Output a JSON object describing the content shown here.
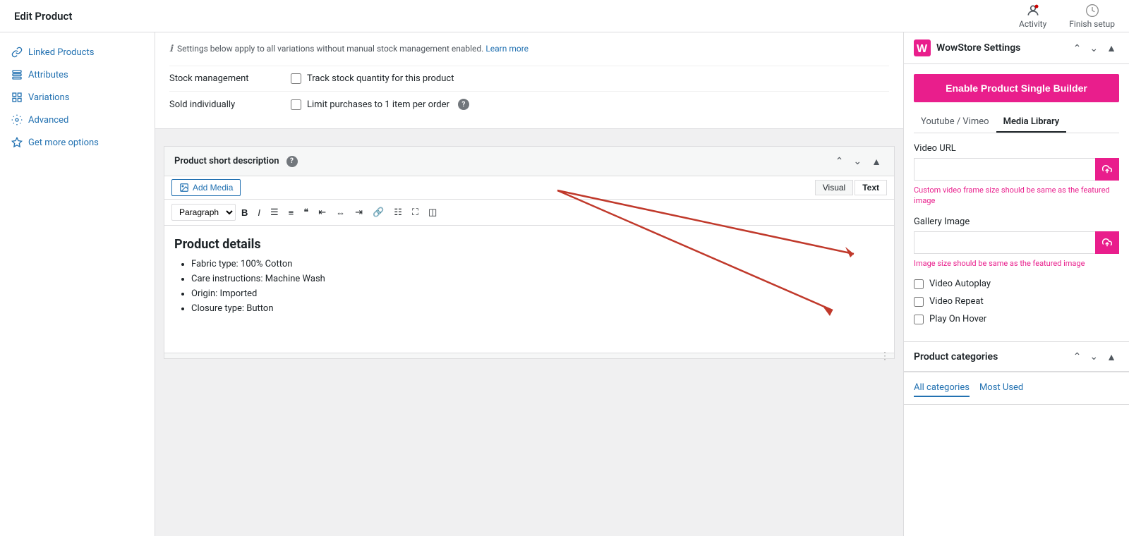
{
  "page": {
    "title": "Edit Product"
  },
  "topbar": {
    "title": "Edit Product",
    "activity_label": "Activity",
    "finish_setup_label": "Finish setup"
  },
  "sidebar": {
    "items": [
      {
        "id": "linked-products",
        "label": "Linked Products",
        "icon": "link"
      },
      {
        "id": "attributes",
        "label": "Attributes",
        "icon": "list"
      },
      {
        "id": "variations",
        "label": "Variations",
        "icon": "grid"
      },
      {
        "id": "advanced",
        "label": "Advanced",
        "icon": "gear"
      },
      {
        "id": "get-more-options",
        "label": "Get more options",
        "icon": "star"
      }
    ]
  },
  "stock_section": {
    "notice": "Settings below apply to all variations without manual stock management enabled.",
    "notice_link": "Learn more",
    "stock_management_label": "Stock management",
    "stock_management_checkbox": "Track stock quantity for this product",
    "sold_individually_label": "Sold individually",
    "sold_individually_checkbox": "Limit purchases to 1 item per order"
  },
  "editor_section": {
    "title": "Product short description",
    "add_media_label": "Add Media",
    "tab_visual": "Visual",
    "tab_text": "Text",
    "format_label": "Paragraph",
    "content_heading": "Product details",
    "content_items": [
      "Fabric type: 100% Cotton",
      "Care instructions: Machine Wash",
      "Origin: Imported",
      "Closure type: Button"
    ]
  },
  "wowstore": {
    "logo_text": "W",
    "title": "WowStore Settings",
    "enable_button": "Enable Product Single Builder",
    "tab_youtube": "Youtube / Vimeo",
    "tab_media": "Media Library",
    "video_url_label": "Video URL",
    "video_url_placeholder": "",
    "video_hint": "Custom video frame size should be same as the featured image",
    "gallery_image_label": "Gallery Image",
    "gallery_image_placeholder": "",
    "gallery_hint": "Image size should be same as the featured image",
    "video_autoplay_label": "Video Autoplay",
    "video_repeat_label": "Video Repeat",
    "play_on_hover_label": "Play On Hover"
  },
  "product_categories": {
    "title": "Product categories",
    "tab_all": "All categories",
    "tab_most_used": "Most Used"
  },
  "colors": {
    "pink": "#e91e8c",
    "blue": "#2271b1"
  }
}
